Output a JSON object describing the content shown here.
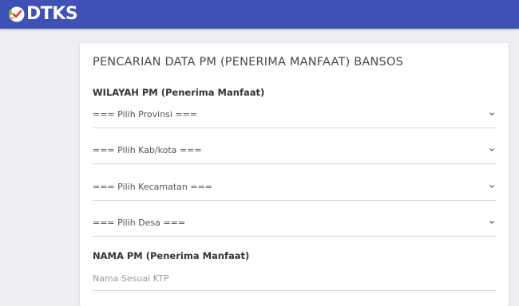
{
  "header": {
    "logo_text": "DTKS",
    "bar_color": "#3f51b5"
  },
  "form": {
    "title": "PENCARIAN DATA PM (PENERIMA MANFAAT) BANSOS",
    "wilayah_label": "WILAYAH PM (Penerima Manfaat)",
    "selects": [
      {
        "placeholder": "=== Pilih Provinsi ==="
      },
      {
        "placeholder": "=== Pilih Kab/kota ==="
      },
      {
        "placeholder": "=== Pilih Kecamatan ==="
      },
      {
        "placeholder": "=== Pilih Desa ==="
      }
    ],
    "nama_label": "NAMA PM (Penerima Manfaat)",
    "nama_placeholder": "Nama Sesuai KTP"
  }
}
